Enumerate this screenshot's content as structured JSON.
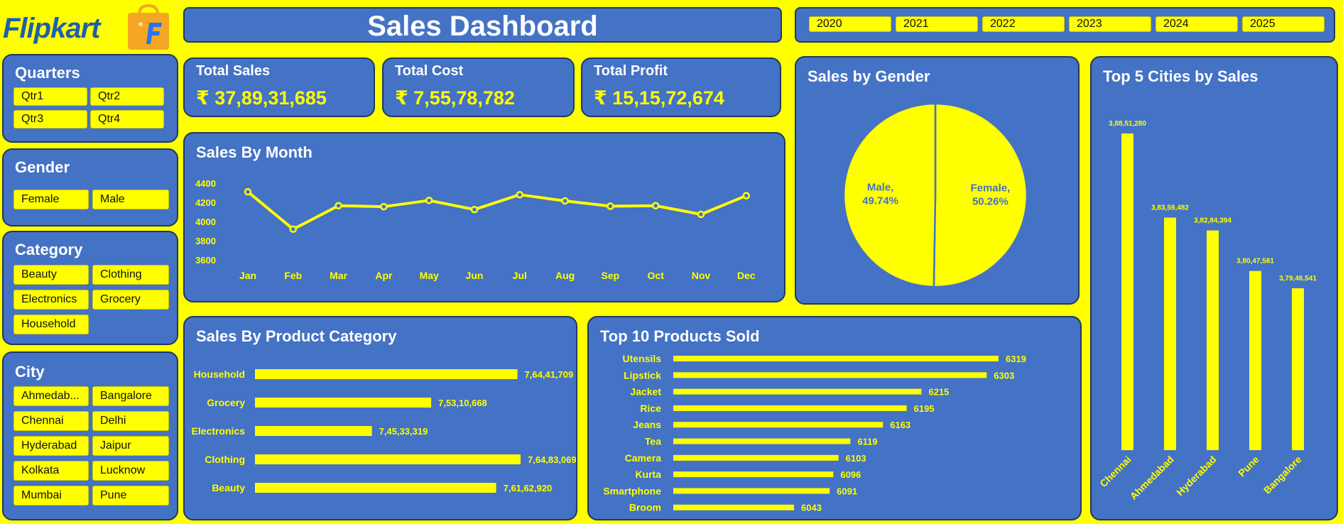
{
  "logo": {
    "text": "Flipkart",
    "colors": {
      "text": "#1F5FA8",
      "bag": "#F5A623",
      "mark": "#2874F0"
    }
  },
  "header": {
    "title": "Sales Dashboard"
  },
  "years": [
    "2020",
    "2021",
    "2022",
    "2023",
    "2024",
    "2025"
  ],
  "slicers": {
    "quarters": {
      "title": "Quarters",
      "items": [
        "Qtr1",
        "Qtr2",
        "Qtr3",
        "Qtr4"
      ]
    },
    "gender": {
      "title": "Gender",
      "items": [
        "Female",
        "Male"
      ]
    },
    "category": {
      "title": "Category",
      "items": [
        "Beauty",
        "Clothing",
        "Electronics",
        "Grocery",
        "Household"
      ]
    },
    "city": {
      "title": "City",
      "items": [
        "Ahmedab...",
        "Bangalore",
        "Chennai",
        "Delhi",
        "Hyderabad",
        "Jaipur",
        "Kolkata",
        "Lucknow",
        "Mumbai",
        "Pune"
      ]
    }
  },
  "kpis": {
    "total_sales": {
      "label": "Total Sales",
      "value": "₹ 37,89,31,685"
    },
    "total_cost": {
      "label": "Total Cost",
      "value": "₹ 7,55,78,782"
    },
    "total_profit": {
      "label": "Total Profit",
      "value": "₹ 15,15,72,674"
    }
  },
  "colors": {
    "panel": "#4472C4",
    "accent": "#FFFF00",
    "border": "#1F3864",
    "text": "#FFFFFF"
  },
  "chart_data": [
    {
      "id": "sales_by_month",
      "type": "line",
      "title": "Sales By Month",
      "categories": [
        "Jan",
        "Feb",
        "Mar",
        "Apr",
        "May",
        "Jun",
        "Jul",
        "Aug",
        "Sep",
        "Oct",
        "Nov",
        "Dec"
      ],
      "values": [
        4310,
        3920,
        4165,
        4155,
        4220,
        4125,
        4280,
        4215,
        4160,
        4165,
        4075,
        4270
      ],
      "yticks": [
        3600,
        3800,
        4000,
        4200,
        4400
      ],
      "ylim": [
        3600,
        4400
      ],
      "grid": false
    },
    {
      "id": "sales_by_gender",
      "type": "pie",
      "title": "Sales by Gender",
      "slices": [
        {
          "label": "Female",
          "value": 50.26,
          "text": "Female,\n50.26%"
        },
        {
          "label": "Male",
          "value": 49.74,
          "text": "Male,\n49.74%"
        }
      ]
    },
    {
      "id": "top5_cities",
      "type": "bar",
      "title": "Top 5 Cities by Sales",
      "categories": [
        "Chennai",
        "Ahmedabad",
        "Hyderabad",
        "Pune",
        "Bangalore"
      ],
      "values": [
        38851280,
        38359482,
        38284394,
        38047581,
        37946541
      ],
      "labels": [
        "3,88,51,280",
        "3,83,59,482",
        "3,82,84,394",
        "3,80,47,581",
        "3,79,46,541"
      ]
    },
    {
      "id": "sales_by_category",
      "type": "bar",
      "orientation": "horizontal",
      "title": "Sales By Product Category",
      "categories": [
        "Household",
        "Grocery",
        "Electronics",
        "Clothing",
        "Beauty"
      ],
      "values": [
        76441709,
        75310668,
        74533319,
        76483069,
        76162920
      ],
      "labels": [
        "7,64,41,709",
        "7,53,10,668",
        "7,45,33,319",
        "7,64,83,069",
        "7,61,62,920"
      ]
    },
    {
      "id": "top10_products",
      "type": "bar",
      "orientation": "horizontal",
      "title": "Top 10 Products Sold",
      "categories": [
        "Utensils",
        "Lipstick",
        "Jacket",
        "Rice",
        "Jeans",
        "Tea",
        "Camera",
        "Kurta",
        "Smartphone",
        "Broom"
      ],
      "values": [
        6319,
        6303,
        6215,
        6195,
        6163,
        6119,
        6103,
        6096,
        6091,
        6043
      ]
    }
  ]
}
